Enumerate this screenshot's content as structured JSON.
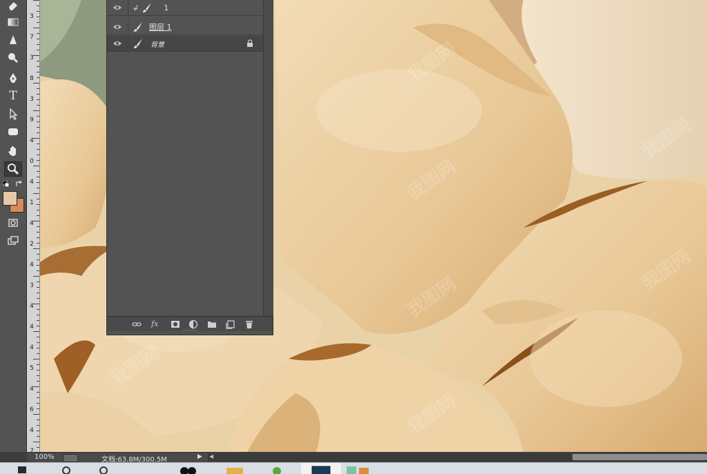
{
  "tools": [
    {
      "name": "eraser-tool",
      "icon": "eraser-icon"
    },
    {
      "name": "gradient-tool",
      "icon": "gradient-icon"
    },
    {
      "name": "blur-tool",
      "icon": "drop-icon"
    },
    {
      "name": "dodge-tool",
      "icon": "dodge-icon"
    },
    {
      "name": "pen-tool",
      "icon": "pen-icon"
    },
    {
      "name": "type-tool",
      "icon": "type-icon",
      "glyph": "T"
    },
    {
      "name": "path-selection-tool",
      "icon": "arrow-cursor-icon"
    },
    {
      "name": "shape-tool",
      "icon": "rounded-rect-icon"
    },
    {
      "name": "hand-tool",
      "icon": "hand-icon"
    },
    {
      "name": "zoom-tool",
      "icon": "magnifier-icon",
      "active": true
    }
  ],
  "colors": {
    "foreground": "#e6c8a8",
    "background": "#d98a5a"
  },
  "ruler": {
    "labels": [
      "3",
      "7",
      "3",
      "8",
      "3",
      "9",
      "4",
      "0",
      "4",
      "1",
      "4",
      "2",
      "4",
      "3",
      "4",
      "4",
      "4",
      "5",
      "4",
      "6",
      "4",
      "7"
    ]
  },
  "layers": {
    "rows": [
      {
        "name": "1",
        "clipped": true,
        "clip_glyph": "↲",
        "locked": false
      },
      {
        "name": "图层 1",
        "clipped": false,
        "locked": false
      },
      {
        "name": "背景",
        "clipped": false,
        "locked": true
      }
    ],
    "footer_icons": [
      "link-icon",
      "fx-icon",
      "mask-icon",
      "adjustment-icon",
      "folder-icon",
      "new-layer-icon",
      "trash-icon"
    ],
    "fx_label": "fx"
  },
  "status": {
    "zoom": "100%",
    "doc_size": "文档:63.8M/300.5M",
    "arrow": "▶",
    "scroll_left": "◀"
  },
  "watermark": "我图网"
}
